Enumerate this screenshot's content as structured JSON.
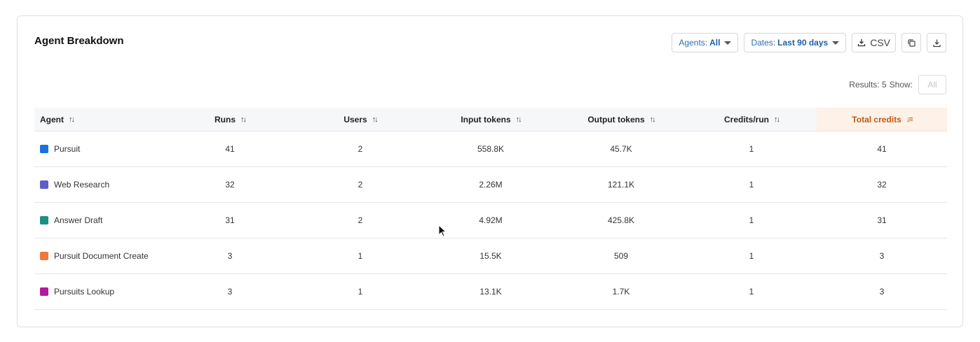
{
  "panel": {
    "title": "Agent Breakdown"
  },
  "toolbar": {
    "agents_label": "Agents:",
    "agents_value": "All",
    "dates_label": "Dates:",
    "dates_value": "Last 90 days",
    "csv_label": "CSV",
    "icons": [
      "download-icon",
      "copy-icon",
      "download-icon"
    ]
  },
  "results": {
    "label": "Results: 5",
    "show_label": "Show:",
    "show_value": "All"
  },
  "table": {
    "columns": [
      "Agent",
      "Runs",
      "Users",
      "Input tokens",
      "Output tokens",
      "Credits/run",
      "Total credits"
    ],
    "sorted_column": "Total credits",
    "rows": [
      {
        "agent": "Pursuit",
        "color": "#1a73d9",
        "runs": "41",
        "users": "2",
        "input_tokens": "558.8K",
        "output_tokens": "45.7K",
        "credits_per_run": "1",
        "total_credits": "41"
      },
      {
        "agent": "Web Research",
        "color": "#5b5fc7",
        "runs": "32",
        "users": "2",
        "input_tokens": "2.26M",
        "output_tokens": "121.1K",
        "credits_per_run": "1",
        "total_credits": "32"
      },
      {
        "agent": "Answer Draft",
        "color": "#1b9088",
        "runs": "31",
        "users": "2",
        "input_tokens": "4.92M",
        "output_tokens": "425.8K",
        "credits_per_run": "1",
        "total_credits": "31"
      },
      {
        "agent": "Pursuit Document Create",
        "color": "#f0783c",
        "runs": "3",
        "users": "1",
        "input_tokens": "15.5K",
        "output_tokens": "509",
        "credits_per_run": "1",
        "total_credits": "3"
      },
      {
        "agent": "Pursuits Lookup",
        "color": "#b5179e",
        "runs": "3",
        "users": "1",
        "input_tokens": "13.1K",
        "output_tokens": "1.7K",
        "credits_per_run": "1",
        "total_credits": "3"
      }
    ]
  },
  "colors": {
    "accent": "#2f6fb0",
    "sorted_header_bg": "#fdf1e8",
    "sorted_header_text": "#c05a14"
  }
}
